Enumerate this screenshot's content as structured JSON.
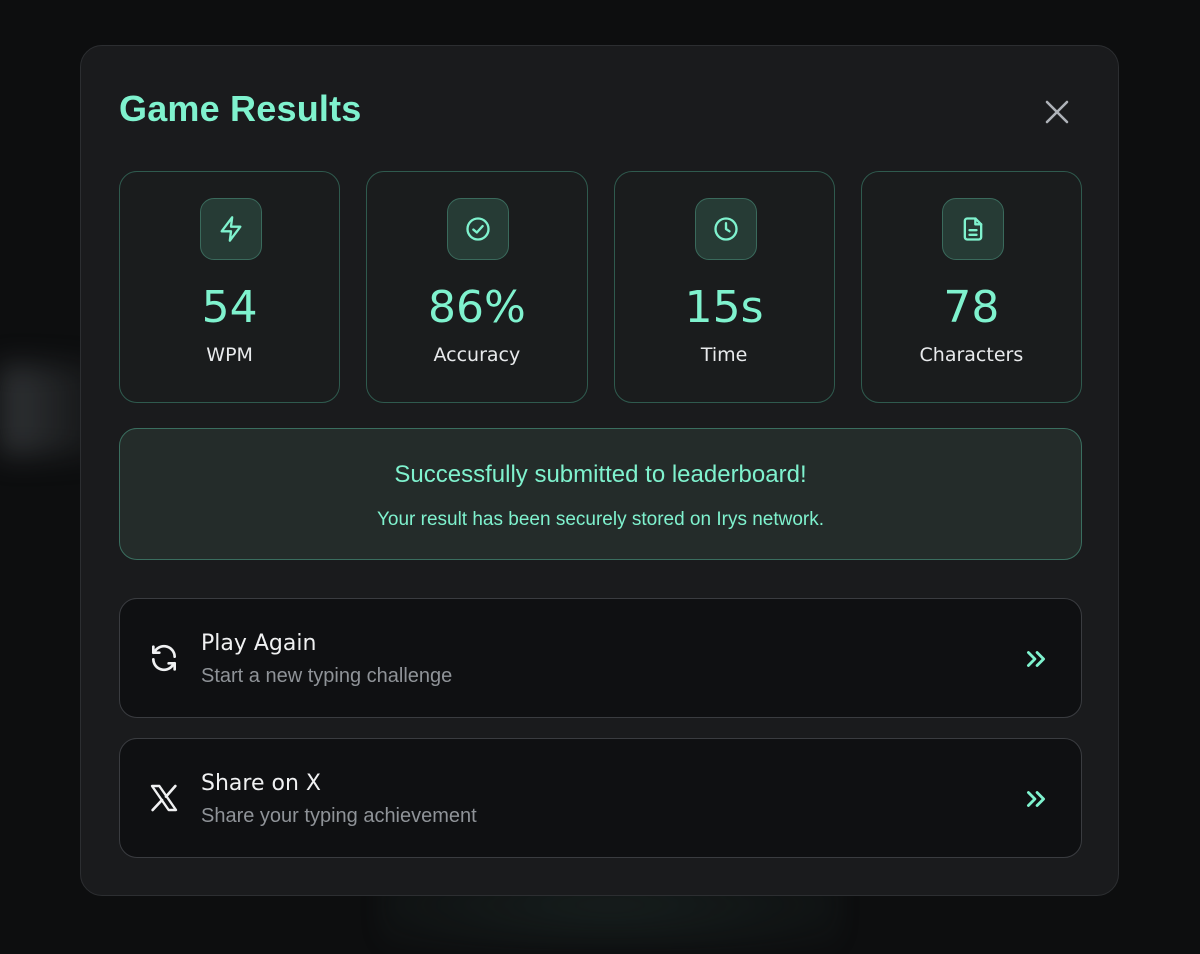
{
  "modal": {
    "title": "Game Results"
  },
  "stats": [
    {
      "icon": "lightning-icon",
      "value": "54",
      "label": "WPM"
    },
    {
      "icon": "check-circle-icon",
      "value": "86%",
      "label": "Accuracy"
    },
    {
      "icon": "clock-icon",
      "value": "15s",
      "label": "Time"
    },
    {
      "icon": "document-icon",
      "value": "78",
      "label": "Characters"
    }
  ],
  "notice": {
    "heading": "Successfully submitted to leaderboard!",
    "subtext": "Your result has been securely stored on Irys network."
  },
  "actions": [
    {
      "icon": "refresh-icon",
      "title": "Play Again",
      "subtitle": "Start a new typing challenge"
    },
    {
      "icon": "x-logo-icon",
      "title": "Share on X",
      "subtitle": "Share your typing achievement"
    }
  ],
  "colors": {
    "accent": "#7ff2ce",
    "modal_bg": "#1a1b1d",
    "page_bg": "#0d0e0f",
    "success_bg": "#242c2a"
  }
}
